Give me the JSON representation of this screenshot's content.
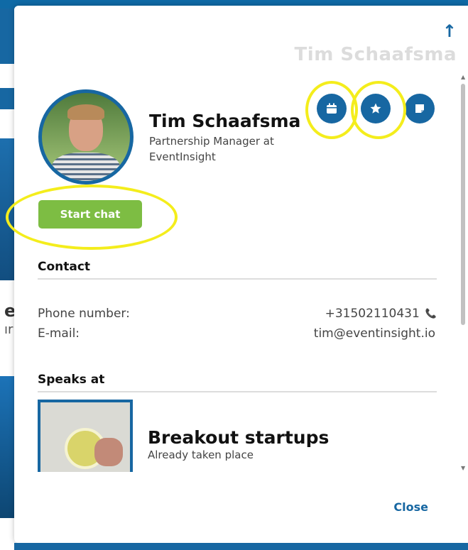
{
  "background": {
    "letter_1": "e",
    "letter_2": "ır"
  },
  "modal": {
    "header_title": "Tim Schaafsma",
    "profile": {
      "name": "Tim Schaafsma",
      "role": "Partnership Manager at EventInsight"
    },
    "actions": [
      {
        "icon": "calendar-icon"
      },
      {
        "icon": "star-icon"
      },
      {
        "icon": "note-icon"
      }
    ],
    "start_chat_label": "Start chat",
    "contact": {
      "title": "Contact",
      "phone_label": "Phone number:",
      "phone_value": "+31502110431",
      "email_label": "E-mail:",
      "email_value": "tim@eventinsight.io"
    },
    "speaks_at": {
      "title": "Speaks at",
      "session_title": "Breakout startups",
      "session_status": "Already taken place"
    },
    "close_label": "Close"
  },
  "colors": {
    "brand": "#1767a2",
    "chat_button": "#7dbd43",
    "highlight": "#f4ed1c",
    "phone_icon": "#2ea04a"
  }
}
